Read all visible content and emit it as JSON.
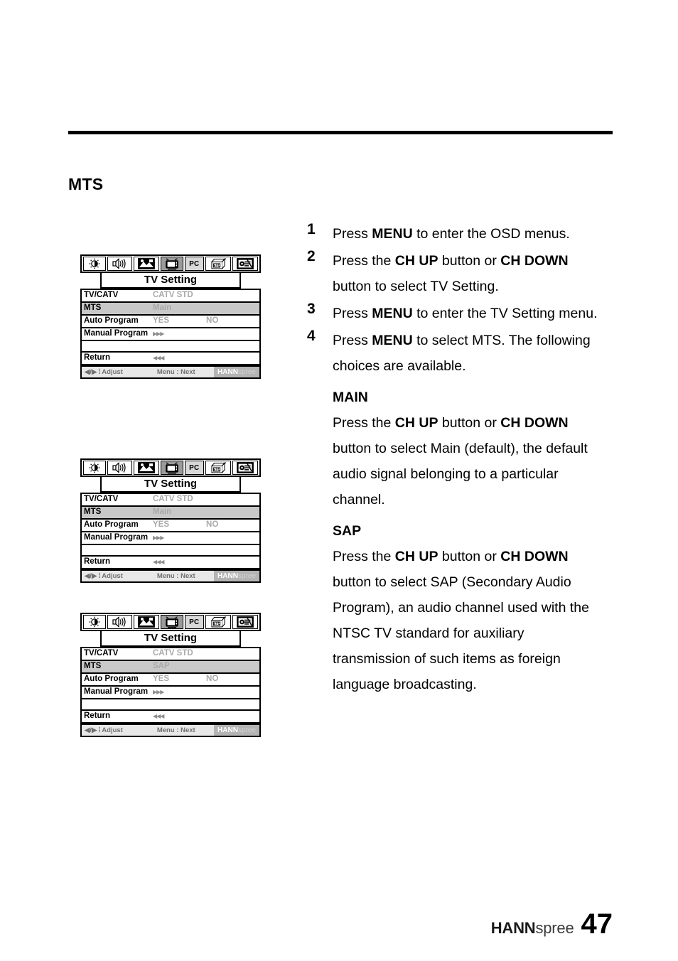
{
  "page": {
    "section_title": "MTS",
    "page_number": "47",
    "brand_bold": "HANN",
    "brand_light": "spree"
  },
  "steps": [
    {
      "num": "1",
      "parts": [
        {
          "t": "Press ",
          "b": false
        },
        {
          "t": "MENU",
          "b": true
        },
        {
          "t": " to enter the OSD menus.",
          "b": false
        }
      ]
    },
    {
      "num": "2",
      "parts": [
        {
          "t": "Press the ",
          "b": false
        },
        {
          "t": "CH UP",
          "b": true
        },
        {
          "t": " button or ",
          "b": false
        },
        {
          "t": "CH DOWN",
          "b": true
        },
        {
          "t": " button to select TV Setting.",
          "b": false
        }
      ]
    },
    {
      "num": "3",
      "parts": [
        {
          "t": "Press ",
          "b": false
        },
        {
          "t": "MENU",
          "b": true
        },
        {
          "t": " to enter the TV Setting menu.",
          "b": false
        }
      ]
    },
    {
      "num": "4",
      "parts": [
        {
          "t": "Press ",
          "b": false
        },
        {
          "t": "MENU",
          "b": true
        },
        {
          "t": " to select MTS. The following choices are available.",
          "b": false
        }
      ]
    }
  ],
  "choices": [
    {
      "heading": "MAIN",
      "parts": [
        {
          "t": "Press the ",
          "b": false
        },
        {
          "t": "CH UP",
          "b": true
        },
        {
          "t": " button or ",
          "b": false
        },
        {
          "t": "CH DOWN",
          "b": true
        },
        {
          "t": " button to select Main (default), the default audio signal belonging to a particular channel.",
          "b": false
        }
      ]
    },
    {
      "heading": "SAP",
      "parts": [
        {
          "t": "Press the ",
          "b": false
        },
        {
          "t": "CH UP",
          "b": true
        },
        {
          "t": " button or ",
          "b": false
        },
        {
          "t": "CH DOWN",
          "b": true
        },
        {
          "t": " button to select SAP (Secondary Audio Program), an audio channel used with the NTSC TV standard for auxiliary transmission of such items as foreign language broadcasting.",
          "b": false
        }
      ]
    }
  ],
  "osd": {
    "icons": [
      {
        "name": "brightness-contrast-icon",
        "label": "",
        "state": "normal"
      },
      {
        "name": "volume-speaker-icon",
        "label": "",
        "state": "normal"
      },
      {
        "name": "picture-image-icon",
        "label": "",
        "state": "normal"
      },
      {
        "name": "tv-icon",
        "label": "",
        "state": "selected"
      },
      {
        "name": "pc-icon",
        "label": "PC",
        "state": "pc"
      },
      {
        "name": "etc-box-icon",
        "label": "",
        "state": "normal"
      },
      {
        "name": "setup-tools-icon",
        "label": "",
        "state": "normal"
      }
    ],
    "title": "TV Setting",
    "rows": [
      {
        "label": "TV/CATV",
        "value": "CATV STD",
        "value2": "",
        "arrows": "",
        "highlight": false
      },
      {
        "label": "MTS",
        "value": "Main",
        "value2": "",
        "arrows": "",
        "highlight": true
      },
      {
        "label": "Auto Program",
        "value": "YES",
        "value2": "NO",
        "arrows": "",
        "highlight": false
      },
      {
        "label": "Manual Program",
        "value": "",
        "value2": "",
        "arrows": "▶▶▶",
        "highlight": false
      },
      {
        "label": "",
        "value": "",
        "value2": "",
        "arrows": "",
        "highlight": false
      },
      {
        "label": "Return",
        "value": "",
        "value2": "",
        "arrows": "◀◀◀",
        "highlight": false
      }
    ],
    "footer": {
      "left": "◀/▶  ⦙ Adjust",
      "mid": "Menu : Next",
      "logo_bold": "HANN",
      "logo_light": "spree"
    },
    "mts_value_main": "Main",
    "mts_value_sap": "SAP"
  },
  "osd_instances": [
    {
      "id": "osd-menu-1",
      "mts_value": "Main"
    },
    {
      "id": "osd-menu-2",
      "mts_value": "Main"
    },
    {
      "id": "osd-menu-3",
      "mts_value": "SAP"
    }
  ]
}
